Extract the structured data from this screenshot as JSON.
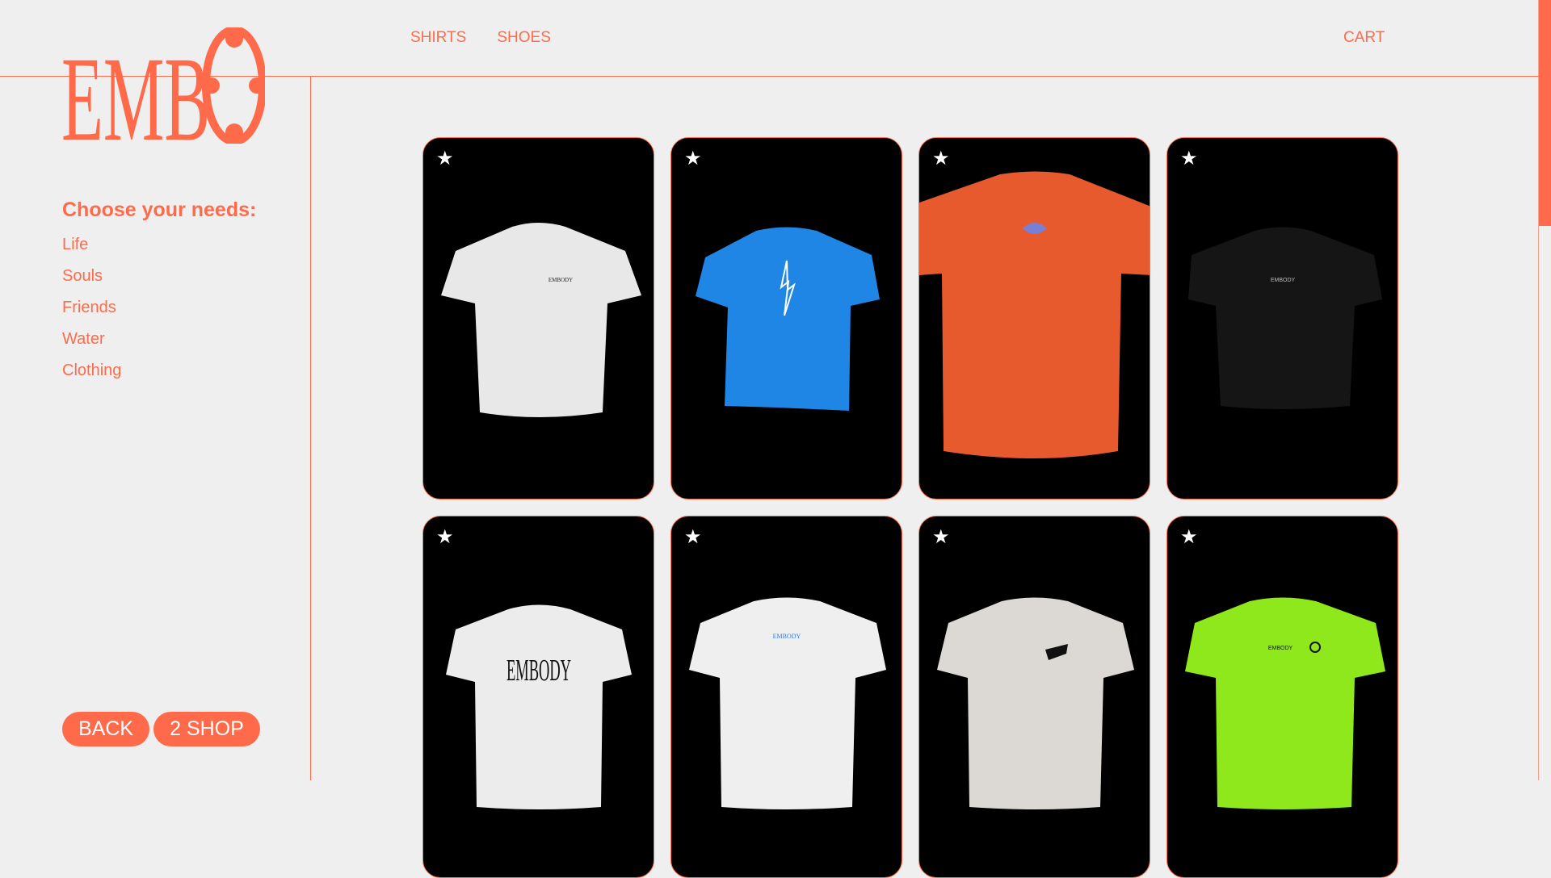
{
  "brand": {
    "logo_text": "EMB"
  },
  "header": {
    "nav": [
      {
        "label": "SHIRTS"
      },
      {
        "label": "SHOES"
      }
    ],
    "cart_label": "CART"
  },
  "sidebar": {
    "title": "Choose your needs:",
    "items": [
      {
        "label": "Life"
      },
      {
        "label": "Souls"
      },
      {
        "label": "Friends"
      },
      {
        "label": "Water"
      },
      {
        "label": "Clothing"
      }
    ],
    "back_label": "BACK",
    "shop_label": "2 SHOP"
  },
  "products": [
    {
      "star": "★",
      "shirt_color": "#e8e8e8",
      "print_text": "EMBODY",
      "print_color": "#222222"
    },
    {
      "star": "★",
      "shirt_color": "#1f86e6",
      "print_text": "",
      "print_color": "#ffffff"
    },
    {
      "star": "★",
      "shirt_color": "#e65a2e",
      "print_text": "",
      "print_color": "#7a7fd6"
    },
    {
      "star": "★",
      "shirt_color": "#151515",
      "print_text": "EMBODY",
      "print_color": "#bbbbbb"
    },
    {
      "star": "★",
      "shirt_color": "#ececec",
      "print_text": "EMBODY",
      "print_color": "#111111"
    },
    {
      "star": "★",
      "shirt_color": "#efefef",
      "print_text": "EMBODY",
      "print_color": "#2f7de0"
    },
    {
      "star": "★",
      "shirt_color": "#dcd9d4",
      "print_text": "",
      "print_color": "#111111"
    },
    {
      "star": "★",
      "shirt_color": "#8ee81c",
      "print_text": "EMBODY",
      "print_color": "#111111"
    }
  ],
  "colors": {
    "accent": "#ff6b4a",
    "background": "#f0efef",
    "card": "#000000"
  }
}
